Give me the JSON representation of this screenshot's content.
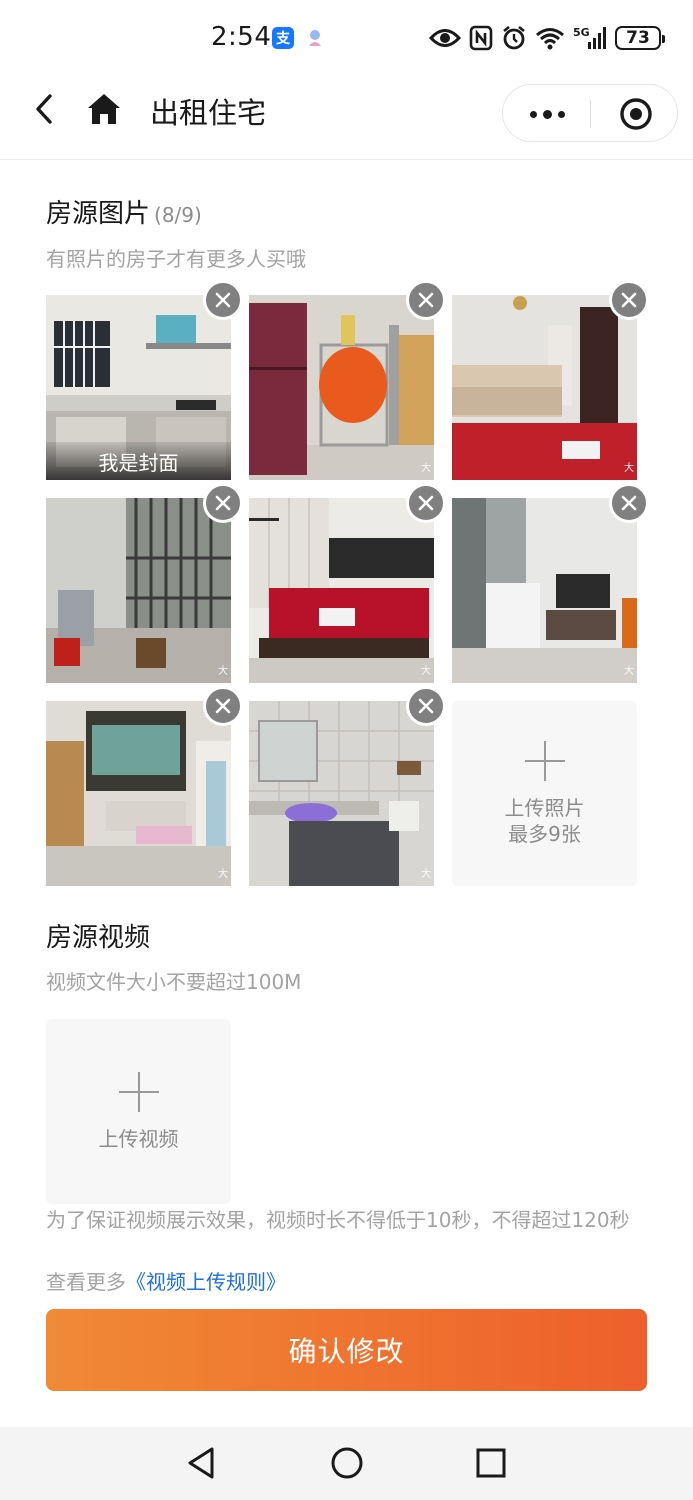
{
  "status_bar": {
    "time": "2:54",
    "alipay_glyph": "支",
    "network": "5G",
    "battery": "73",
    "icons": [
      "eye-icon",
      "nfc-icon",
      "alarm-icon",
      "wifi-icon",
      "signal-icon",
      "battery-icon"
    ]
  },
  "nav": {
    "title": "出租住宅",
    "icons": [
      "back-arrow-icon",
      "home-icon",
      "more-dots-icon",
      "close-target-icon"
    ]
  },
  "photos": {
    "title": "房源图片",
    "count": "(8/9)",
    "hint": "有照片的房子才有更多人买哦",
    "cover_label": "我是封面",
    "watermark": "大",
    "items": [
      {
        "subject": "kitchen",
        "colors": {
          "wall": "#e9e8e3",
          "floor": "#b9b6b0",
          "accent": "#5ab0c0"
        }
      },
      {
        "subject": "fridge",
        "colors": {
          "wall": "#d9d6cf",
          "floor": "#cfcbc4",
          "accent": "#7a2a3a"
        }
      },
      {
        "subject": "sofa",
        "colors": {
          "wall": "#e5e3df",
          "floor": "#c8c5c0",
          "accent": "#c0202a"
        }
      },
      {
        "subject": "balcony",
        "colors": {
          "wall": "#cfcfcb",
          "floor": "#b5b1aa",
          "accent": "#5a5a5a"
        }
      },
      {
        "subject": "bed",
        "colors": {
          "wall": "#ecebe7",
          "floor": "#cdcac4",
          "accent": "#b8122a"
        }
      },
      {
        "subject": "tv",
        "colors": {
          "wall": "#e8e8e6",
          "floor": "#d1cec9",
          "accent": "#3a3a3a"
        }
      },
      {
        "subject": "living-room",
        "colors": {
          "wall": "#dfdcd6",
          "floor": "#c9c6c0",
          "accent": "#5a3d2a"
        }
      },
      {
        "subject": "bathroom",
        "colors": {
          "wall": "#d8d6d2",
          "floor": "#bfbbb5",
          "accent": "#8c6fd6"
        }
      }
    ],
    "upload_label_1": "上传照片",
    "upload_label_2": "最多9张"
  },
  "video": {
    "title": "房源视频",
    "hint": "视频文件大小不要超过100M",
    "upload_label": "上传视频",
    "note": "为了保证视频展示效果，视频时长不得低于10秒，不得超过120秒",
    "more_prefix": "查看更多",
    "more_link": "《视频上传规则》"
  },
  "confirm_button": "确认修改",
  "colors": {
    "accent_start": "#f08a35",
    "accent_end": "#ee5f2b",
    "link": "#1c6fe6",
    "hint_text": "#a3a3a3",
    "delete_badge": "#808080"
  }
}
